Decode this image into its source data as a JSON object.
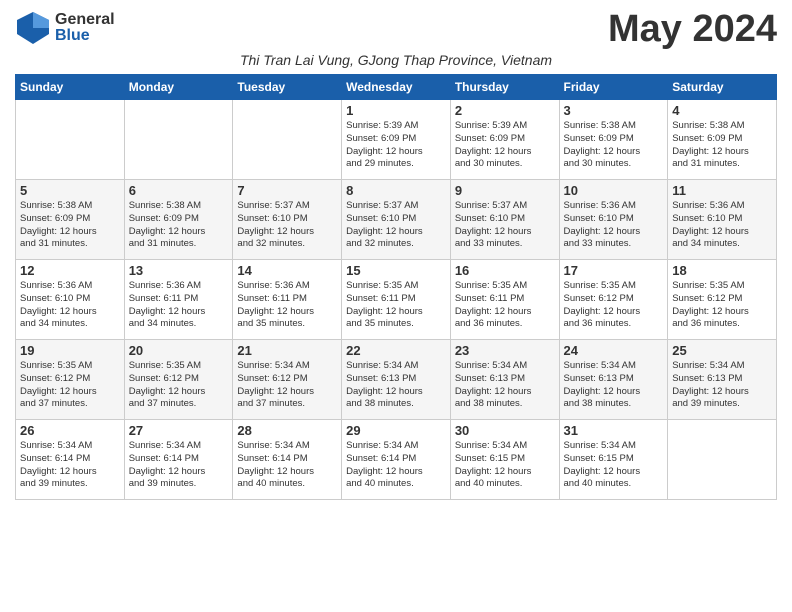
{
  "header": {
    "logo_general": "General",
    "logo_blue": "Blue",
    "month_title": "May 2024",
    "subtitle": "Thi Tran Lai Vung, GJong Thap Province, Vietnam"
  },
  "columns": [
    "Sunday",
    "Monday",
    "Tuesday",
    "Wednesday",
    "Thursday",
    "Friday",
    "Saturday"
  ],
  "weeks": [
    [
      {
        "day": "",
        "info": ""
      },
      {
        "day": "",
        "info": ""
      },
      {
        "day": "",
        "info": ""
      },
      {
        "day": "1",
        "info": "Sunrise: 5:39 AM\nSunset: 6:09 PM\nDaylight: 12 hours\nand 29 minutes."
      },
      {
        "day": "2",
        "info": "Sunrise: 5:39 AM\nSunset: 6:09 PM\nDaylight: 12 hours\nand 30 minutes."
      },
      {
        "day": "3",
        "info": "Sunrise: 5:38 AM\nSunset: 6:09 PM\nDaylight: 12 hours\nand 30 minutes."
      },
      {
        "day": "4",
        "info": "Sunrise: 5:38 AM\nSunset: 6:09 PM\nDaylight: 12 hours\nand 31 minutes."
      }
    ],
    [
      {
        "day": "5",
        "info": "Sunrise: 5:38 AM\nSunset: 6:09 PM\nDaylight: 12 hours\nand 31 minutes."
      },
      {
        "day": "6",
        "info": "Sunrise: 5:38 AM\nSunset: 6:09 PM\nDaylight: 12 hours\nand 31 minutes."
      },
      {
        "day": "7",
        "info": "Sunrise: 5:37 AM\nSunset: 6:10 PM\nDaylight: 12 hours\nand 32 minutes."
      },
      {
        "day": "8",
        "info": "Sunrise: 5:37 AM\nSunset: 6:10 PM\nDaylight: 12 hours\nand 32 minutes."
      },
      {
        "day": "9",
        "info": "Sunrise: 5:37 AM\nSunset: 6:10 PM\nDaylight: 12 hours\nand 33 minutes."
      },
      {
        "day": "10",
        "info": "Sunrise: 5:36 AM\nSunset: 6:10 PM\nDaylight: 12 hours\nand 33 minutes."
      },
      {
        "day": "11",
        "info": "Sunrise: 5:36 AM\nSunset: 6:10 PM\nDaylight: 12 hours\nand 34 minutes."
      }
    ],
    [
      {
        "day": "12",
        "info": "Sunrise: 5:36 AM\nSunset: 6:10 PM\nDaylight: 12 hours\nand 34 minutes."
      },
      {
        "day": "13",
        "info": "Sunrise: 5:36 AM\nSunset: 6:11 PM\nDaylight: 12 hours\nand 34 minutes."
      },
      {
        "day": "14",
        "info": "Sunrise: 5:36 AM\nSunset: 6:11 PM\nDaylight: 12 hours\nand 35 minutes."
      },
      {
        "day": "15",
        "info": "Sunrise: 5:35 AM\nSunset: 6:11 PM\nDaylight: 12 hours\nand 35 minutes."
      },
      {
        "day": "16",
        "info": "Sunrise: 5:35 AM\nSunset: 6:11 PM\nDaylight: 12 hours\nand 36 minutes."
      },
      {
        "day": "17",
        "info": "Sunrise: 5:35 AM\nSunset: 6:12 PM\nDaylight: 12 hours\nand 36 minutes."
      },
      {
        "day": "18",
        "info": "Sunrise: 5:35 AM\nSunset: 6:12 PM\nDaylight: 12 hours\nand 36 minutes."
      }
    ],
    [
      {
        "day": "19",
        "info": "Sunrise: 5:35 AM\nSunset: 6:12 PM\nDaylight: 12 hours\nand 37 minutes."
      },
      {
        "day": "20",
        "info": "Sunrise: 5:35 AM\nSunset: 6:12 PM\nDaylight: 12 hours\nand 37 minutes."
      },
      {
        "day": "21",
        "info": "Sunrise: 5:34 AM\nSunset: 6:12 PM\nDaylight: 12 hours\nand 37 minutes."
      },
      {
        "day": "22",
        "info": "Sunrise: 5:34 AM\nSunset: 6:13 PM\nDaylight: 12 hours\nand 38 minutes."
      },
      {
        "day": "23",
        "info": "Sunrise: 5:34 AM\nSunset: 6:13 PM\nDaylight: 12 hours\nand 38 minutes."
      },
      {
        "day": "24",
        "info": "Sunrise: 5:34 AM\nSunset: 6:13 PM\nDaylight: 12 hours\nand 38 minutes."
      },
      {
        "day": "25",
        "info": "Sunrise: 5:34 AM\nSunset: 6:13 PM\nDaylight: 12 hours\nand 39 minutes."
      }
    ],
    [
      {
        "day": "26",
        "info": "Sunrise: 5:34 AM\nSunset: 6:14 PM\nDaylight: 12 hours\nand 39 minutes."
      },
      {
        "day": "27",
        "info": "Sunrise: 5:34 AM\nSunset: 6:14 PM\nDaylight: 12 hours\nand 39 minutes."
      },
      {
        "day": "28",
        "info": "Sunrise: 5:34 AM\nSunset: 6:14 PM\nDaylight: 12 hours\nand 40 minutes."
      },
      {
        "day": "29",
        "info": "Sunrise: 5:34 AM\nSunset: 6:14 PM\nDaylight: 12 hours\nand 40 minutes."
      },
      {
        "day": "30",
        "info": "Sunrise: 5:34 AM\nSunset: 6:15 PM\nDaylight: 12 hours\nand 40 minutes."
      },
      {
        "day": "31",
        "info": "Sunrise: 5:34 AM\nSunset: 6:15 PM\nDaylight: 12 hours\nand 40 minutes."
      },
      {
        "day": "",
        "info": ""
      }
    ]
  ]
}
